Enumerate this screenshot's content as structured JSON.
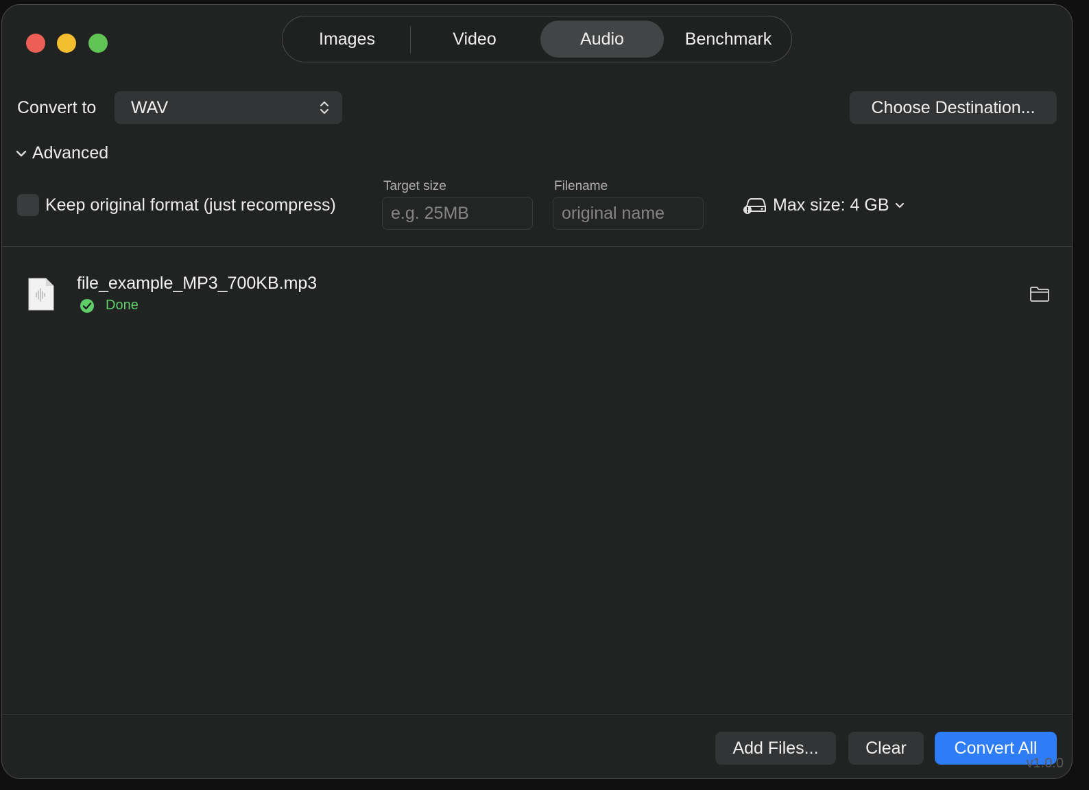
{
  "tabs": [
    {
      "label": "Images"
    },
    {
      "label": "Video"
    },
    {
      "label": "Audio",
      "active": true
    },
    {
      "label": "Benchmark"
    }
  ],
  "convert": {
    "label": "Convert to",
    "format": "WAV"
  },
  "destination_button": "Choose Destination...",
  "advanced": {
    "label": "Advanced",
    "keep_original_label": "Keep original format (just recompress)",
    "keep_original_checked": false,
    "target_size": {
      "label": "Target size",
      "value": "",
      "placeholder": "e.g. 25MB"
    },
    "filename": {
      "label": "Filename",
      "value": "",
      "placeholder": "original name"
    },
    "max_size_label": "Max size: 4 GB"
  },
  "files": [
    {
      "name": "file_example_MP3_700KB.mp3",
      "status": "Done"
    }
  ],
  "footer": {
    "add_files": "Add Files...",
    "clear": "Clear",
    "convert_all": "Convert All",
    "version": "v1.0.0"
  },
  "colors": {
    "accent": "#2e7cf6",
    "done": "#5fcf6a",
    "close": "#ec5f57",
    "minimize": "#f4bf2e",
    "maximize": "#5fc453"
  }
}
